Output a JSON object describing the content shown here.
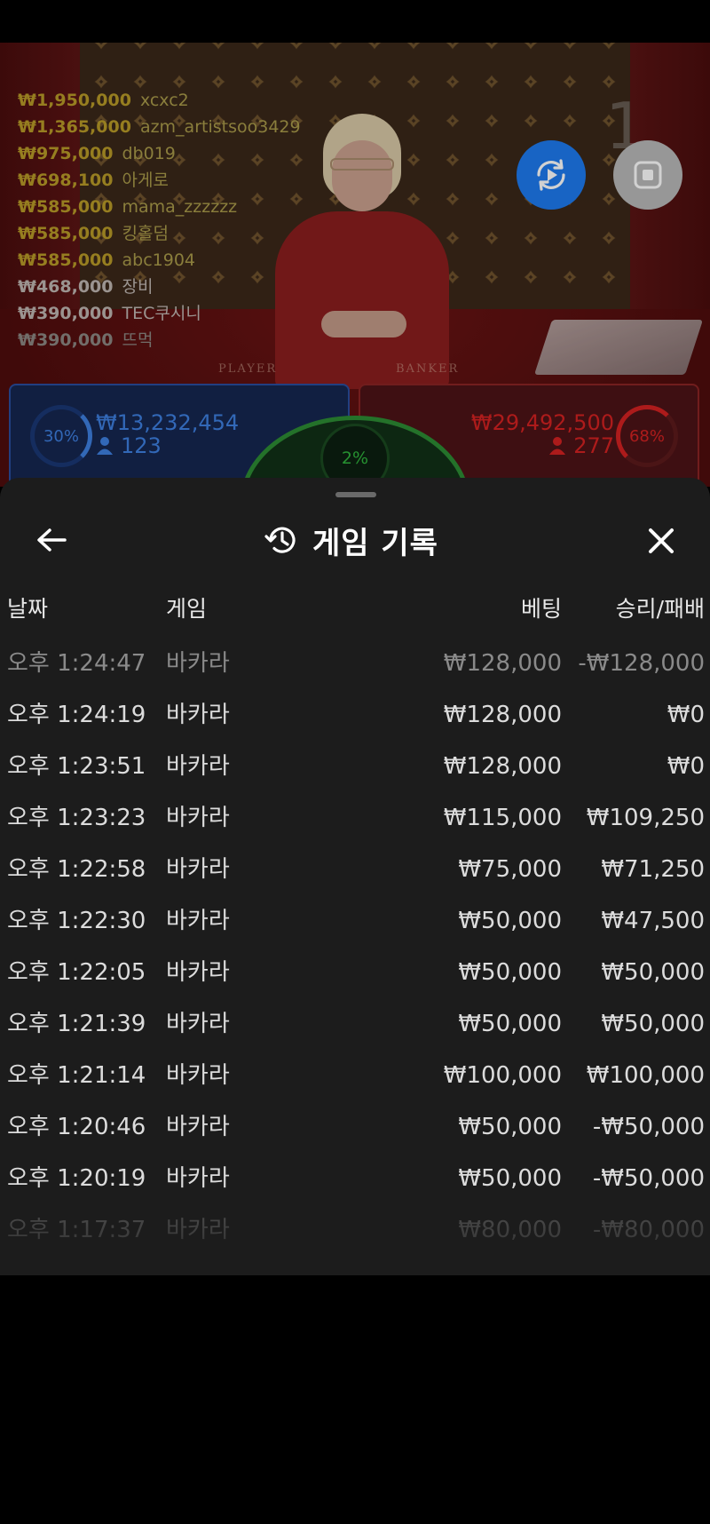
{
  "leaderboard": [
    {
      "amount": "₩1,950,000",
      "name": "xcxc2"
    },
    {
      "amount": "₩1,365,000",
      "name": "azm_artistsoo3429"
    },
    {
      "amount": "₩975,000",
      "name": "db019"
    },
    {
      "amount": "₩698,100",
      "name": "아게로"
    },
    {
      "amount": "₩585,000",
      "name": "mama_zzzzzz"
    },
    {
      "amount": "₩585,000",
      "name": "킹홀덤"
    },
    {
      "amount": "₩585,000",
      "name": "abc1904"
    },
    {
      "amount": "₩468,000",
      "name": "장비"
    },
    {
      "amount": "₩390,000",
      "name": "TEC쿠시니"
    },
    {
      "amount": "₩390,000",
      "name": "뜨먹"
    }
  ],
  "stream": {
    "history_digit": "1",
    "felt_player": "PLAYER",
    "felt_banker": "BANKER"
  },
  "bets": {
    "player": {
      "percent": "30%",
      "amount": "₩13,232,454",
      "players": "123",
      "color": "#3e7fe0"
    },
    "tie": {
      "percent": "2%",
      "color": "#2fb23c"
    },
    "banker": {
      "percent": "68%",
      "amount": "₩29,492,500",
      "players": "277",
      "color": "#d42222"
    }
  },
  "controls": {
    "replay_icon": "replay-icon",
    "stop_icon": "stop-icon"
  },
  "sheet": {
    "title": "게임 기록",
    "history_icon": "history-icon",
    "back_icon": "arrow-left-icon",
    "close_icon": "close-icon",
    "columns": {
      "date": "날짜",
      "game": "게임",
      "bet": "베팅",
      "result": "승리/패배"
    },
    "rows": [
      {
        "time": "오후 1:24:47",
        "game": "바카라",
        "bet": "₩128,000",
        "result": "-₩128,000"
      },
      {
        "time": "오후 1:24:19",
        "game": "바카라",
        "bet": "₩128,000",
        "result": "₩0"
      },
      {
        "time": "오후 1:23:51",
        "game": "바카라",
        "bet": "₩128,000",
        "result": "₩0"
      },
      {
        "time": "오후 1:23:23",
        "game": "바카라",
        "bet": "₩115,000",
        "result": "₩109,250"
      },
      {
        "time": "오후 1:22:58",
        "game": "바카라",
        "bet": "₩75,000",
        "result": "₩71,250"
      },
      {
        "time": "오후 1:22:30",
        "game": "바카라",
        "bet": "₩50,000",
        "result": "₩47,500"
      },
      {
        "time": "오후 1:22:05",
        "game": "바카라",
        "bet": "₩50,000",
        "result": "₩50,000"
      },
      {
        "time": "오후 1:21:39",
        "game": "바카라",
        "bet": "₩50,000",
        "result": "₩50,000"
      },
      {
        "time": "오후 1:21:14",
        "game": "바카라",
        "bet": "₩100,000",
        "result": "₩100,000"
      },
      {
        "time": "오후 1:20:46",
        "game": "바카라",
        "bet": "₩50,000",
        "result": "-₩50,000"
      },
      {
        "time": "오후 1:20:19",
        "game": "바카라",
        "bet": "₩50,000",
        "result": "-₩50,000"
      },
      {
        "time": "오후 1:17:37",
        "game": "바카라",
        "bet": "₩80,000",
        "result": "-₩80,000"
      }
    ]
  }
}
